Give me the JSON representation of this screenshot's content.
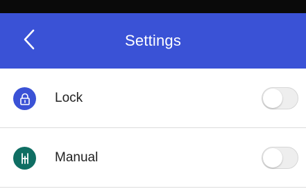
{
  "header": {
    "title": "Settings",
    "back_icon": "chevron-left-icon",
    "background_color": "#3a52d6"
  },
  "settings": [
    {
      "label": "Lock",
      "icon": "lock-icon",
      "icon_color": "#3a52d6",
      "enabled": false
    },
    {
      "label": "Manual",
      "icon": "manual-gear-icon",
      "icon_color": "#0f6e63",
      "enabled": false
    }
  ]
}
